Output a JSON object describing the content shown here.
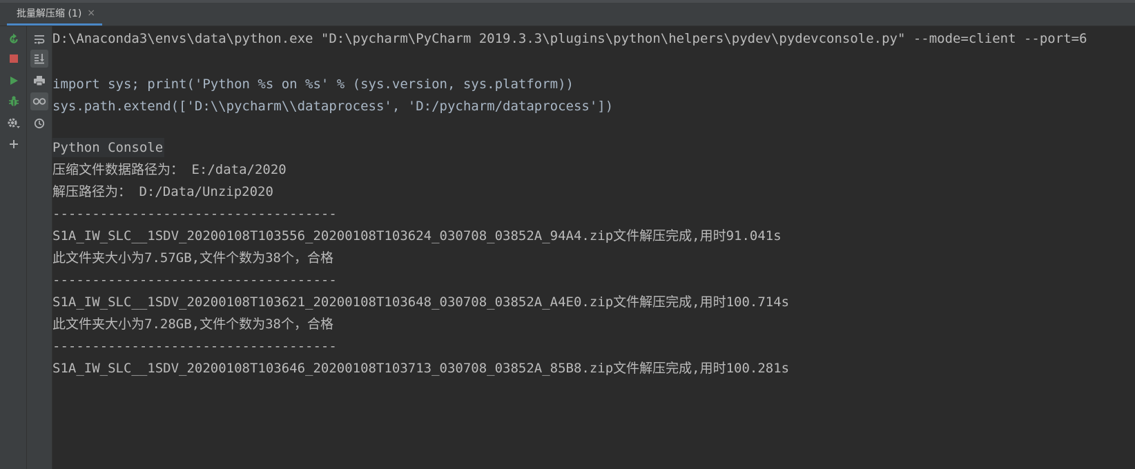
{
  "tab": {
    "title": "批量解压缩 (1)",
    "close_glyph": "×"
  },
  "left_toolbar": {
    "icons": [
      "rerun-icon",
      "stop-icon",
      "run-icon",
      "debug-icon",
      "settings-icon",
      "add-icon"
    ]
  },
  "side_toolbar": {
    "icons": [
      "soft-wrap-icon",
      "scroll-to-end-icon",
      "print-icon",
      "show-variables-icon",
      "history-icon"
    ]
  },
  "console": {
    "command": "D:\\Anaconda3\\envs\\data\\python.exe \"D:\\pycharm\\PyCharm 2019.3.3\\plugins\\python\\helpers\\pydev\\pydevconsole.py\" --mode=client --port=6",
    "lines": [
      "import sys; print('Python %s on %s' % (sys.version, sys.platform))",
      "sys.path.extend(['D:\\\\pycharm\\\\dataprocess', 'D:/pycharm/dataprocess'])",
      "Python Console",
      "压缩文件数据路径为： E:/data/2020",
      "解压路径为： D:/Data/Unzip2020",
      "------------------------------------",
      "S1A_IW_SLC__1SDV_20200108T103556_20200108T103624_030708_03852A_94A4.zip文件解压完成,用时91.041s",
      "此文件夹大小为7.57GB,文件个数为38个，合格",
      "------------------------------------",
      "S1A_IW_SLC__1SDV_20200108T103621_20200108T103648_030708_03852A_A4E0.zip文件解压完成,用时100.714s",
      "此文件夹大小为7.28GB,文件个数为38个，合格",
      "------------------------------------",
      "S1A_IW_SLC__1SDV_20200108T103646_20200108T103713_030708_03852A_85B8.zip文件解压完成,用时100.281s"
    ]
  },
  "colors": {
    "background": "#2b2b2b",
    "toolbar": "#3c3f41",
    "text": "#bbbbbb",
    "code": "#a9b7c6",
    "run_green": "#499c54",
    "stop_red": "#c75450"
  }
}
